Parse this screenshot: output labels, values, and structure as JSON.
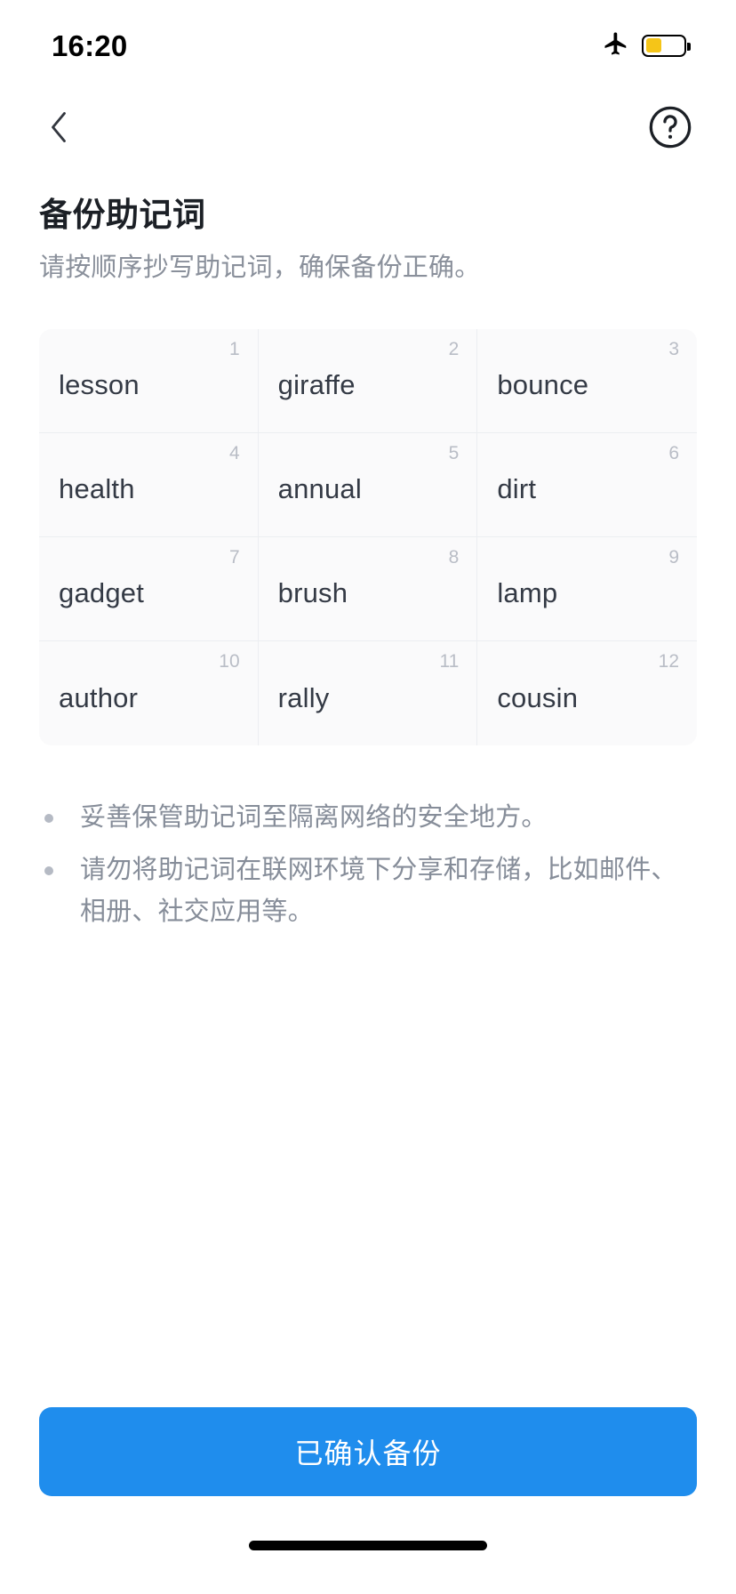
{
  "status_bar": {
    "time": "16:20",
    "airplane_icon": "airplane-mode-icon",
    "battery_icon": "battery-low-power-icon",
    "battery_color": "#f5c518",
    "battery_level_percent": 42
  },
  "nav": {
    "back_icon": "chevron-left-icon",
    "help_icon": "question-mark-circle-icon"
  },
  "header": {
    "title": "备份助记词",
    "subtitle": "请按顺序抄写助记词，确保备份正确。"
  },
  "mnemonic": {
    "columns": 3,
    "words": [
      {
        "index": "1",
        "word": "lesson"
      },
      {
        "index": "2",
        "word": "giraffe"
      },
      {
        "index": "3",
        "word": "bounce"
      },
      {
        "index": "4",
        "word": "health"
      },
      {
        "index": "5",
        "word": "annual"
      },
      {
        "index": "6",
        "word": "dirt"
      },
      {
        "index": "7",
        "word": "gadget"
      },
      {
        "index": "8",
        "word": "brush"
      },
      {
        "index": "9",
        "word": "lamp"
      },
      {
        "index": "10",
        "word": "author"
      },
      {
        "index": "11",
        "word": "rally"
      },
      {
        "index": "12",
        "word": "cousin"
      }
    ]
  },
  "notes": [
    "妥善保管助记词至隔离网络的安全地方。",
    "请勿将助记词在联网环境下分享和存储，比如邮件、相册、社交应用等。"
  ],
  "footer": {
    "primary_button_label": "已确认备份",
    "primary_button_color": "#1f8ded"
  }
}
